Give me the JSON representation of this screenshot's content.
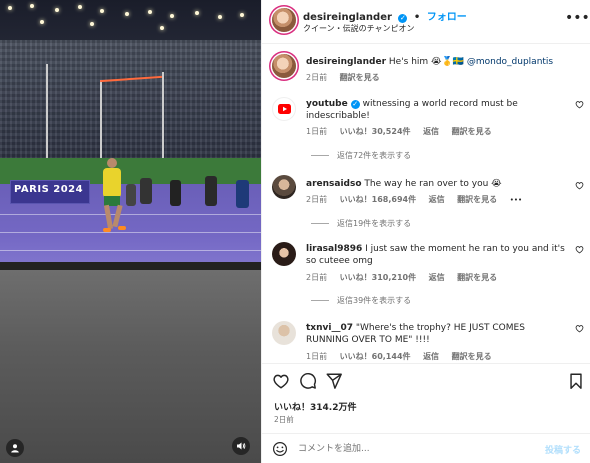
{
  "header": {
    "username": "desireinglander",
    "follow_label": "フォロー",
    "subtitle": "クイーン・伝説のチャンピオン",
    "separator": "•"
  },
  "caption": {
    "username": "desireinglander",
    "text": "He's him 😭🥇🇸🇪",
    "mention": "@mondo_duplantis",
    "time": "2日前",
    "translate": "翻訳を見る"
  },
  "comments": [
    {
      "username": "youtube",
      "verified": true,
      "text": "witnessing a world record must be indescribable!",
      "time": "1日前",
      "likes": "いいね！30,524件",
      "reply": "返信",
      "translate": "翻訳を見る",
      "replies": "返信72件を表示する"
    },
    {
      "username": "arensaidso",
      "text": "The way he ran over to you 😭",
      "time": "2日前",
      "likes": "いいね！168,694件",
      "reply": "返信",
      "translate": "翻訳を見る",
      "more": "•••",
      "replies": "返信19件を表示する"
    },
    {
      "username": "lirasal9896",
      "text": "I just saw the moment he ran to you and it's so cuteee omg",
      "time": "2日前",
      "likes": "いいね！310,210件",
      "reply": "返信",
      "translate": "翻訳を見る",
      "replies": "返信39件を表示する"
    },
    {
      "username": "txnvi__07",
      "text": "\"Where's the trophy? HE JUST COMES RUNNING OVER TO ME\" !!!!",
      "time": "1日前",
      "likes": "いいね！60,144件",
      "reply": "返信",
      "translate": "翻訳を見る"
    }
  ],
  "post": {
    "likes": "いいね！314.2万件",
    "date": "2日前"
  },
  "compose": {
    "placeholder": "コメントを追加...",
    "post_label": "投稿する"
  },
  "media": {
    "board_text": "PARIS 2024"
  },
  "colors": {
    "accent": "#0095f6",
    "text": "#262626",
    "muted": "#737373",
    "youtube": "#ff0000"
  }
}
